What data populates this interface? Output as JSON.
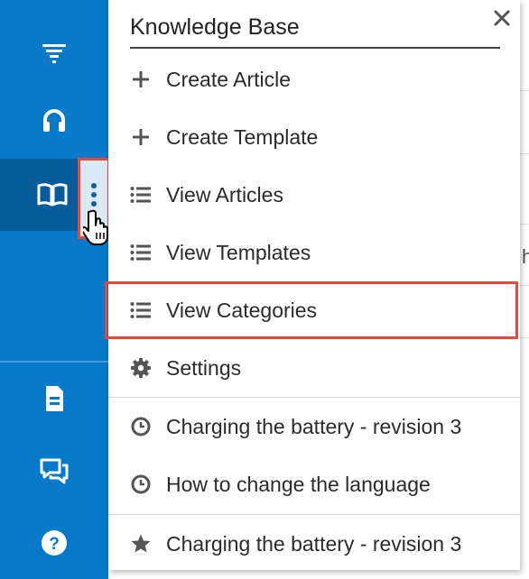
{
  "sidebar": {
    "items": [
      {
        "icon": "filter-icon"
      },
      {
        "icon": "headset-icon"
      },
      {
        "icon": "book-icon",
        "active": true
      },
      {
        "icon": "document-icon"
      },
      {
        "icon": "chat-icon"
      },
      {
        "icon": "help-icon"
      }
    ],
    "kebab_icon": "vertical-dots-icon"
  },
  "menu": {
    "title": "Knowledge Base",
    "close_icon": "close-icon",
    "items": [
      {
        "label": "Create Article",
        "icon": "plus-icon"
      },
      {
        "label": "Create Template",
        "icon": "plus-icon"
      },
      {
        "label": "View Articles",
        "icon": "list-icon"
      },
      {
        "label": "View Templates",
        "icon": "list-icon"
      },
      {
        "label": "View Categories",
        "icon": "list-icon",
        "highlighted": true
      },
      {
        "label": "Settings",
        "icon": "gear-icon"
      }
    ],
    "recent": [
      {
        "label": "Charging the battery - revision 3",
        "icon": "clock-icon"
      },
      {
        "label": "How to change the language",
        "icon": "clock-icon"
      }
    ],
    "favorites": [
      {
        "label": "Charging the battery - revision 3",
        "icon": "star-icon"
      }
    ]
  },
  "background": {
    "partial_text": "h"
  },
  "colors": {
    "rail": "#0679c8",
    "rail_active": "#065b9b",
    "highlight": "#e9473b"
  }
}
